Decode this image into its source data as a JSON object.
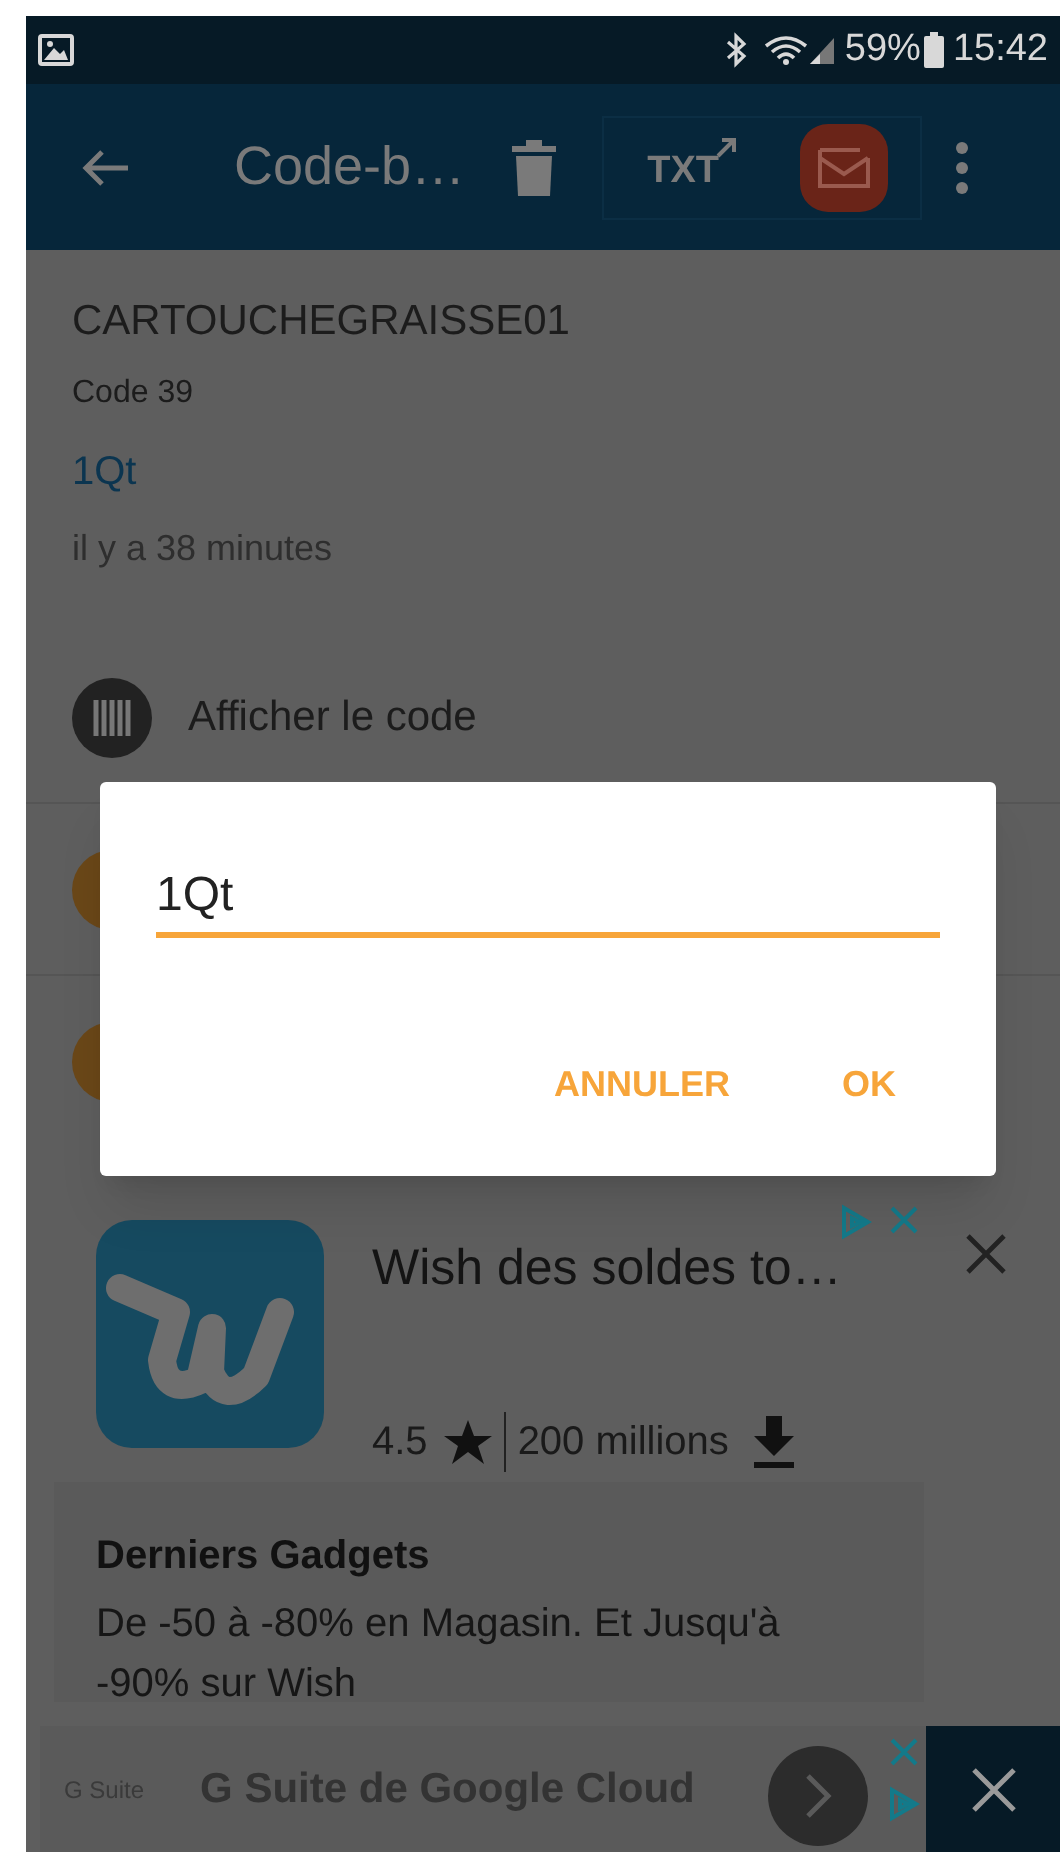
{
  "status_bar": {
    "battery": "59%",
    "time": "15:42"
  },
  "toolbar": {
    "title": "Code-b…",
    "export_label": "TXT"
  },
  "record": {
    "content": "CARTOUCHEGRAISSE01",
    "format": "Code 39",
    "value": "1Qt",
    "time": "il y a 38 minutes"
  },
  "actions": [
    {
      "kind": "barcode",
      "label": "Afficher le code"
    },
    {
      "kind": "round"
    },
    {
      "kind": "round"
    }
  ],
  "dialog": {
    "value": "1Qt",
    "buttons": [
      "ANNULER",
      "OK"
    ]
  },
  "ad": {
    "title": "Wish des soldes to…",
    "rating": "4.5",
    "downloads": "200 millions",
    "headline": "Derniers Gadgets",
    "description": "De -50 à -80% en Magasin. Et Jusqu'à -90% sur Wish"
  },
  "banner": {
    "brand": "G Suite",
    "title": "G Suite de Google Cloud"
  }
}
